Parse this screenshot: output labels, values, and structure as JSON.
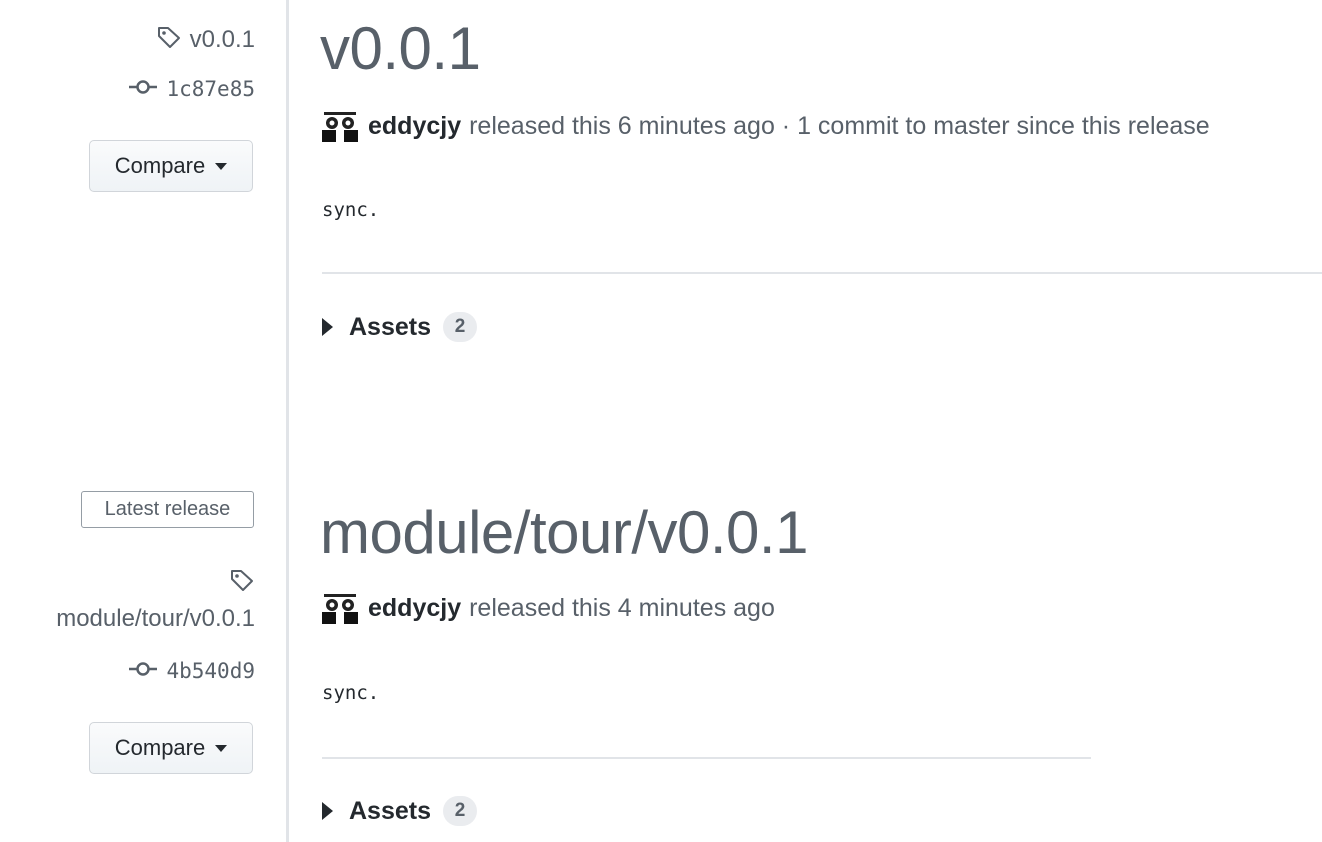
{
  "releases": [
    {
      "sidebar": {
        "tag": "v0.0.1",
        "sha": "1c87e85",
        "compare_label": "Compare"
      },
      "title": "v0.0.1",
      "author": "eddycjy",
      "meta": "released this 6 minutes ago · 1 commit to master since this release",
      "body": "sync.",
      "assets_label": "Assets",
      "assets_count": "2"
    },
    {
      "sidebar": {
        "badge": "Latest release",
        "tag": "module/tour/v0.0.1",
        "sha": "4b540d9",
        "compare_label": "Compare"
      },
      "title": "module/tour/v0.0.1",
      "author": "eddycjy",
      "meta": "released this 4 minutes ago",
      "body": "sync.",
      "assets_label": "Assets",
      "assets_count": "2"
    }
  ],
  "icons": {
    "tag": "tag-icon",
    "commit": "git-commit-icon",
    "caret": "caret-down-icon",
    "disclosure": "triangle-right-icon",
    "avatar": "avatar"
  },
  "colors": {
    "muted_text": "#586069",
    "primary_text": "#24292e",
    "border": "#e1e4e8"
  }
}
